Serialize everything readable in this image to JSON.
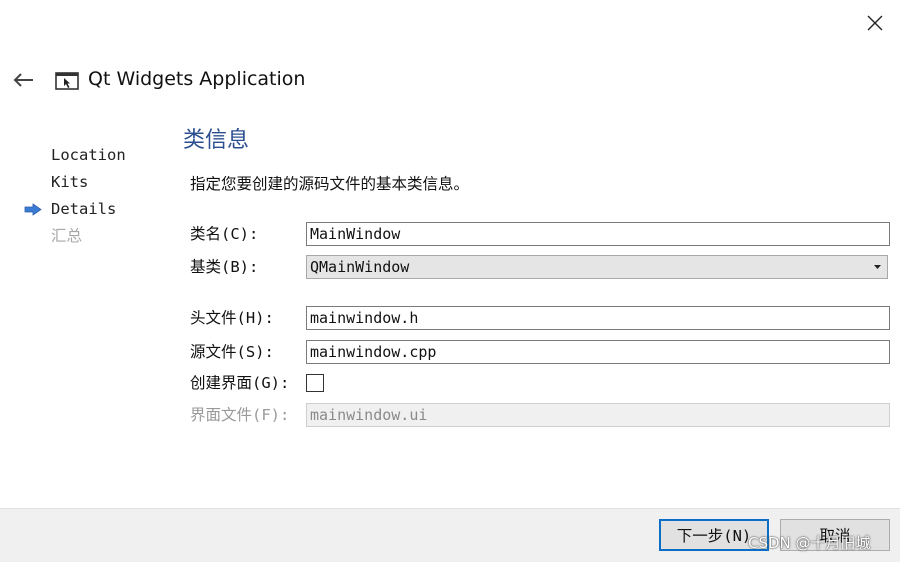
{
  "window": {
    "title": "Qt Widgets Application",
    "close_icon": "close-icon",
    "back_icon": "back-arrow-icon",
    "app_icon": "window-cursor-icon"
  },
  "steps": [
    {
      "label": "Location",
      "state": "done"
    },
    {
      "label": "Kits",
      "state": "done"
    },
    {
      "label": "Details",
      "state": "current"
    },
    {
      "label": "汇总",
      "state": "disabled"
    }
  ],
  "page": {
    "title": "类信息",
    "description": "指定您要创建的源码文件的基本类信息。"
  },
  "form": {
    "class_name": {
      "label": "类名(C):",
      "value": "MainWindow"
    },
    "base_class": {
      "label": "基类(B):",
      "value": "QMainWindow"
    },
    "header_file": {
      "label": "头文件(H):",
      "value": "mainwindow.h"
    },
    "source_file": {
      "label": "源文件(S):",
      "value": "mainwindow.cpp"
    },
    "create_form": {
      "label": "创建界面(G):",
      "checked": false
    },
    "form_file": {
      "label": "界面文件(F):",
      "value": "mainwindow.ui",
      "enabled": false
    }
  },
  "footer": {
    "next_label": "下一步(N)",
    "cancel_label": "取消",
    "watermark": "CSDN @十月旧城"
  },
  "colors": {
    "accent_blue": "#0a6ec6",
    "title_blue": "#2a4e8f",
    "arrow_blue": "#3a7bd5"
  }
}
